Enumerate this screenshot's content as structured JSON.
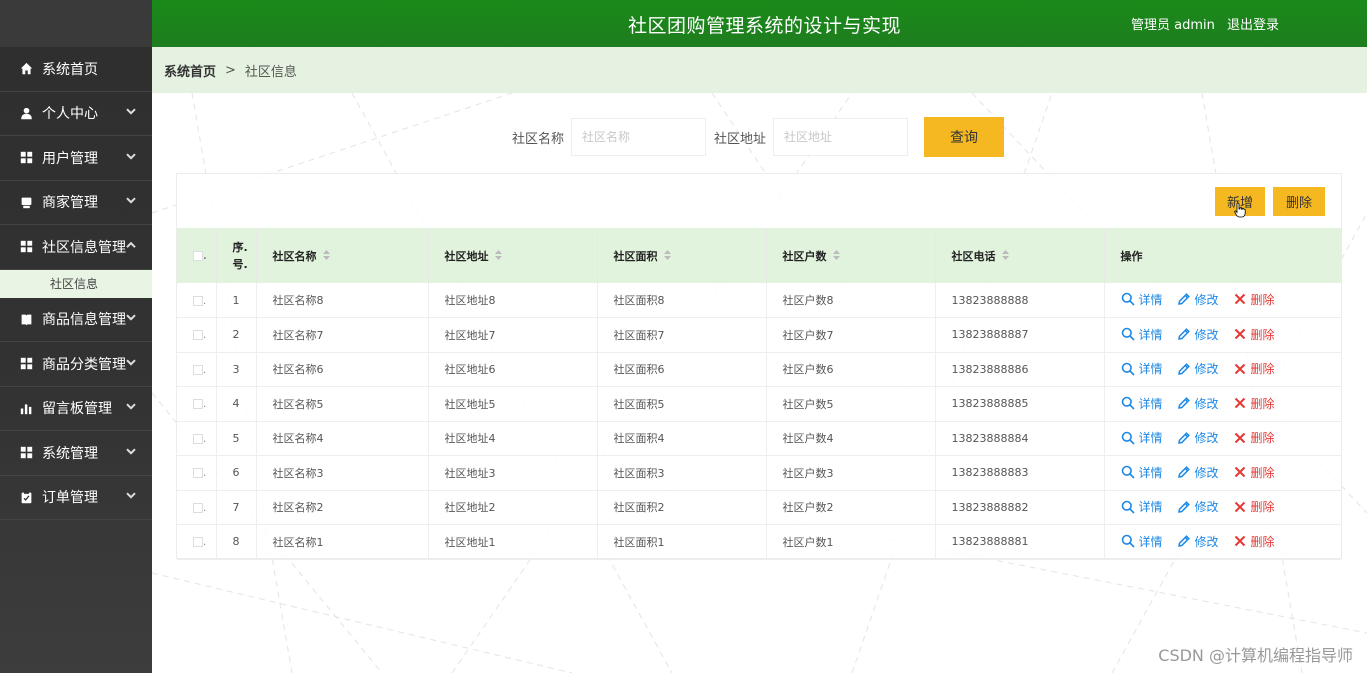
{
  "header": {
    "title": "社区团购管理系统的设计与实现",
    "user_label": "管理员 admin",
    "logout_label": "退出登录"
  },
  "sidebar": {
    "items": [
      {
        "label": "系统首页",
        "icon": "home-icon"
      },
      {
        "label": "个人中心",
        "icon": "user-icon"
      },
      {
        "label": "用户管理",
        "icon": "grid-icon"
      },
      {
        "label": "商家管理",
        "icon": "shop-icon"
      },
      {
        "label": "社区信息管理",
        "icon": "grid-icon"
      },
      {
        "label": "商品信息管理",
        "icon": "book-icon"
      },
      {
        "label": "商品分类管理",
        "icon": "grid-icon"
      },
      {
        "label": "留言板管理",
        "icon": "bar-chart-icon"
      },
      {
        "label": "系统管理",
        "icon": "grid-icon"
      },
      {
        "label": "订单管理",
        "icon": "clipboard-icon"
      }
    ],
    "submenu_label": "社区信息"
  },
  "breadcrumb": {
    "home": "系统首页",
    "separator": ">",
    "current": "社区信息"
  },
  "search": {
    "name_label": "社区名称",
    "name_placeholder": "社区名称",
    "address_label": "社区地址",
    "address_placeholder": "社区地址",
    "query_label": "查询"
  },
  "toolbar": {
    "add_label": "新增",
    "delete_label": "删除"
  },
  "table": {
    "headers": [
      "序.",
      "号.",
      "社区名称",
      "社区地址",
      "社区面积",
      "社区户数",
      "社区电话",
      "操作"
    ],
    "rows": [
      {
        "no": "1",
        "name": "社区名称8",
        "address": "社区地址8",
        "area": "社区面积8",
        "households": "社区户数8",
        "phone": "13823888888"
      },
      {
        "no": "2",
        "name": "社区名称7",
        "address": "社区地址7",
        "area": "社区面积7",
        "households": "社区户数7",
        "phone": "13823888887"
      },
      {
        "no": "3",
        "name": "社区名称6",
        "address": "社区地址6",
        "area": "社区面积6",
        "households": "社区户数6",
        "phone": "13823888886"
      },
      {
        "no": "4",
        "name": "社区名称5",
        "address": "社区地址5",
        "area": "社区面积5",
        "households": "社区户数5",
        "phone": "13823888885"
      },
      {
        "no": "5",
        "name": "社区名称4",
        "address": "社区地址4",
        "area": "社区面积4",
        "households": "社区户数4",
        "phone": "13823888884"
      },
      {
        "no": "6",
        "name": "社区名称3",
        "address": "社区地址3",
        "area": "社区面积3",
        "households": "社区户数3",
        "phone": "13823888883"
      },
      {
        "no": "7",
        "name": "社区名称2",
        "address": "社区地址2",
        "area": "社区面积2",
        "households": "社区户数2",
        "phone": "13823888882"
      },
      {
        "no": "8",
        "name": "社区名称1",
        "address": "社区地址1",
        "area": "社区面积1",
        "households": "社区户数1",
        "phone": "13823888881"
      }
    ],
    "actions": {
      "view": "详情",
      "edit": "修改",
      "delete": "删除"
    }
  },
  "watermark": "CSDN @计算机编程指导师",
  "colors": {
    "header_green": "#1a8a1a",
    "accent_yellow": "#f5b820",
    "link_blue": "#1e88e5",
    "delete_red": "#e53935",
    "breadcrumb_bg": "#e6f2e1",
    "sidebar_bg": "#333333"
  }
}
